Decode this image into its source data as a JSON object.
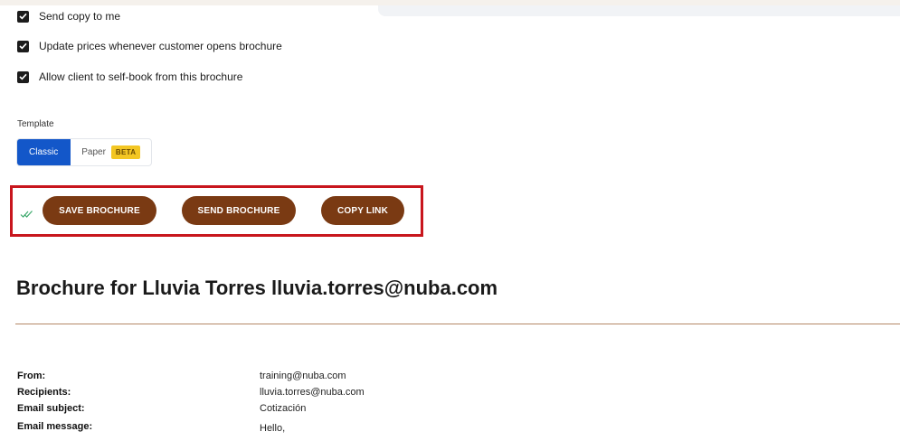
{
  "checkboxes": [
    {
      "label": "Send copy to me",
      "checked": true
    },
    {
      "label": "Update prices whenever customer opens brochure",
      "checked": true
    },
    {
      "label": "Allow client to self-book from this brochure",
      "checked": true
    }
  ],
  "template": {
    "label": "Template",
    "options": [
      {
        "label": "Classic",
        "active": true
      },
      {
        "label": "Paper",
        "active": false,
        "badge": "BETA"
      }
    ]
  },
  "actions": {
    "save_label": "SAVE BROCHURE",
    "send_label": "SEND BROCHURE",
    "copy_label": "COPY LINK"
  },
  "brochure": {
    "title": "Brochure for Lluvia Torres lluvia.torres@nuba.com",
    "fields": [
      {
        "label": "From:",
        "value": "training@nuba.com"
      },
      {
        "label": "Recipients:",
        "value": "lluvia.torres@nuba.com"
      },
      {
        "label": "Email subject:",
        "value": "Cotización"
      },
      {
        "label": "Email message:",
        "value": "Hello,"
      }
    ]
  },
  "colors": {
    "action_brown": "#7a3a13",
    "highlight_red": "#c8161d",
    "classic_blue": "#1357c9",
    "beta_yellow": "#f3c623",
    "divider": "#b48766",
    "saved_check_green": "#3aa86b"
  }
}
